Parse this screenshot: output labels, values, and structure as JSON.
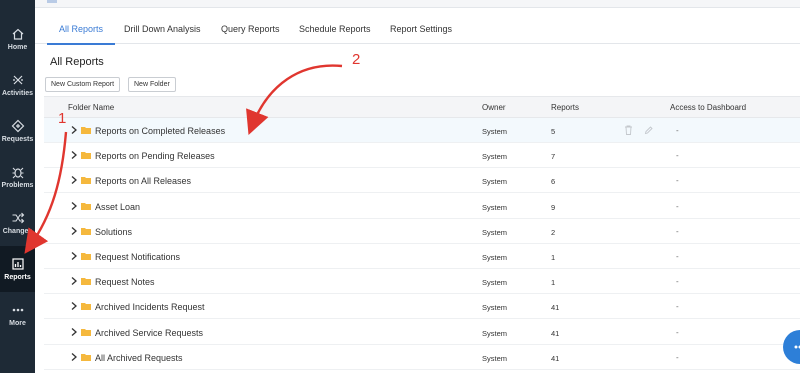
{
  "sidebar": {
    "items": [
      {
        "label": "Home",
        "icon": "home-icon"
      },
      {
        "label": "Activities",
        "icon": "activities-icon"
      },
      {
        "label": "Requests",
        "icon": "requests-icon"
      },
      {
        "label": "Problems",
        "icon": "problems-icon"
      },
      {
        "label": "Changes",
        "icon": "changes-icon"
      },
      {
        "label": "Reports",
        "icon": "reports-icon",
        "active": true
      },
      {
        "label": "More",
        "icon": "more-icon"
      }
    ]
  },
  "tabs": [
    {
      "label": "All Reports",
      "active": true
    },
    {
      "label": "Drill Down Analysis"
    },
    {
      "label": "Query Reports"
    },
    {
      "label": "Schedule Reports"
    },
    {
      "label": "Report Settings"
    }
  ],
  "page": {
    "title": "All Reports",
    "new_custom_report": "New Custom Report",
    "new_folder": "New Folder"
  },
  "table": {
    "columns": [
      "Folder Name",
      "Owner",
      "Reports",
      "Access to Dashboard"
    ],
    "rows": [
      {
        "name": "Reports on Completed Releases",
        "owner": "System",
        "reports": "5",
        "access": "-"
      },
      {
        "name": "Reports on Pending Releases",
        "owner": "System",
        "reports": "7",
        "access": "-"
      },
      {
        "name": "Reports on All Releases",
        "owner": "System",
        "reports": "6",
        "access": "-"
      },
      {
        "name": "Asset Loan",
        "owner": "System",
        "reports": "9",
        "access": "-"
      },
      {
        "name": "Solutions",
        "owner": "System",
        "reports": "2",
        "access": "-"
      },
      {
        "name": "Request Notifications",
        "owner": "System",
        "reports": "1",
        "access": "-"
      },
      {
        "name": "Request Notes",
        "owner": "System",
        "reports": "1",
        "access": "-"
      },
      {
        "name": "Archived Incidents Request",
        "owner": "System",
        "reports": "41",
        "access": "-"
      },
      {
        "name": "Archived Service Requests",
        "owner": "System",
        "reports": "41",
        "access": "-"
      },
      {
        "name": "All Archived Requests",
        "owner": "System",
        "reports": "41",
        "access": "-"
      }
    ]
  },
  "annotations": [
    "1",
    "2"
  ],
  "colors": {
    "accent": "#3a7bd5",
    "sidebar": "#1e2a36",
    "folder": "#f5b83d",
    "annotation": "#e0362f"
  }
}
